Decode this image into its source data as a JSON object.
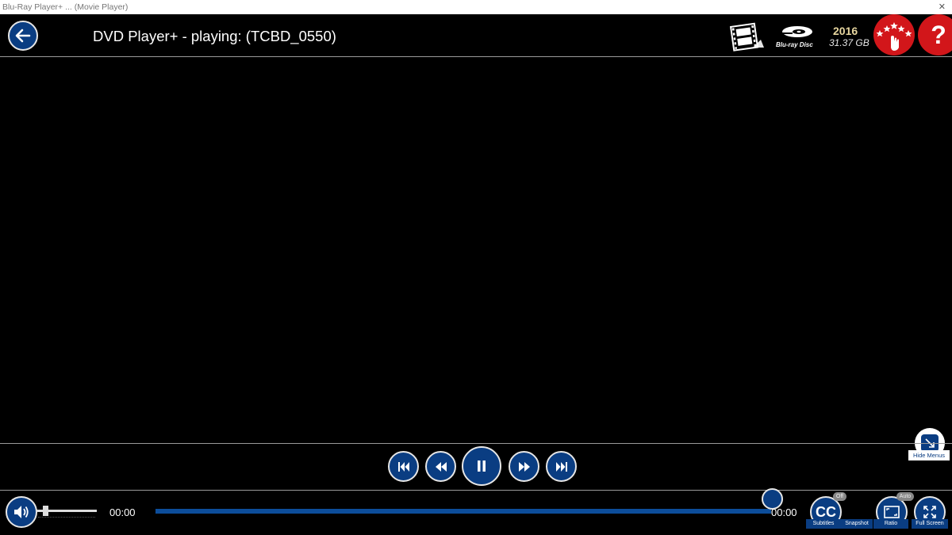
{
  "window": {
    "title": "Blu-Ray Player+ ... (Movie Player)",
    "close_glyph": "✕"
  },
  "header": {
    "title": "DVD Player+ - playing: (TCBD_0550)",
    "bluray_year": "2016",
    "bluray_size": "31.37 GB",
    "help_label": "?"
  },
  "playback": {
    "current_time": "00:00",
    "total_time": "00:00",
    "seek_progress": 1.0,
    "volume_level": 0.15
  },
  "hide_menus": {
    "label": "Hide Menus"
  },
  "toolbar": {
    "subtitles_label": "Subtitles",
    "subtitles_badge": "Off",
    "cc_text": "CC",
    "snapshot_label": "Snapshot",
    "ratio_label": "Ratio",
    "ratio_badge": "Auto",
    "fullscreen_label": "Full Screen"
  },
  "colors": {
    "accent": "#0a3d82",
    "seek": "#0c4d9a",
    "rate_red": "#d2161a",
    "year_gold": "#e8d7a0"
  }
}
